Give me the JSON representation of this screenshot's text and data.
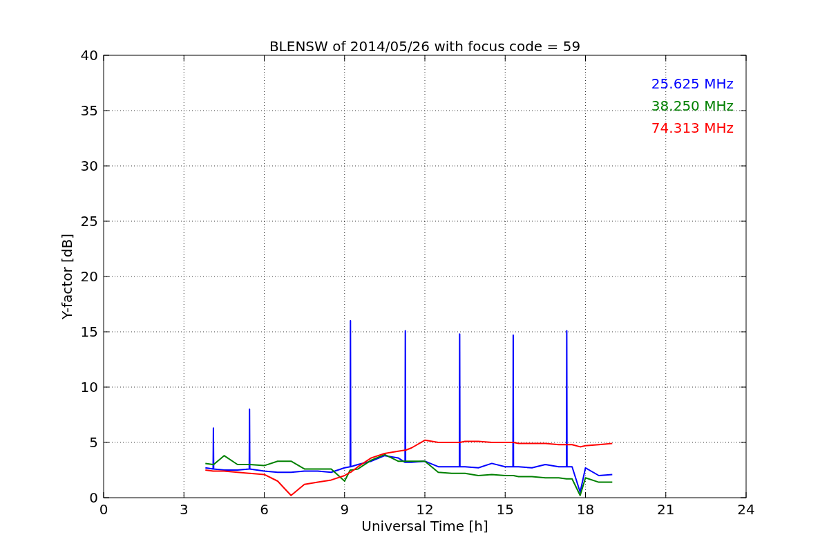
{
  "chart_data": {
    "type": "line",
    "title": "BLENSW of 2014/05/26 with focus code = 59",
    "xlabel": "Universal Time [h]",
    "ylabel": "Y-factor [dB]",
    "x": [
      3.8,
      4.09,
      4.1,
      4.11,
      4.5,
      5.0,
      5.44,
      5.45,
      5.46,
      6.0,
      6.5,
      7.0,
      7.5,
      8.0,
      8.5,
      9.0,
      9.21,
      9.22,
      9.23,
      9.5,
      10.0,
      10.5,
      11.0,
      11.26,
      11.27,
      11.28,
      11.5,
      12.0,
      12.5,
      13.0,
      13.29,
      13.3,
      13.31,
      13.5,
      14.0,
      14.5,
      15.0,
      15.29,
      15.3,
      15.31,
      15.5,
      16.0,
      16.5,
      17.0,
      17.29,
      17.3,
      17.31,
      17.5,
      17.8,
      18.0,
      18.5,
      19.0
    ],
    "series": [
      {
        "name": "25.625 MHz",
        "color": "#0000ff",
        "values": [
          2.7,
          2.6,
          6.3,
          2.6,
          2.5,
          2.5,
          2.6,
          8.0,
          2.6,
          2.4,
          2.3,
          2.3,
          2.4,
          2.4,
          2.3,
          2.7,
          2.8,
          16.0,
          2.8,
          3.0,
          3.3,
          3.8,
          3.6,
          3.2,
          15.1,
          3.2,
          3.2,
          3.3,
          2.8,
          2.8,
          2.8,
          14.8,
          2.8,
          2.8,
          2.7,
          3.1,
          2.8,
          2.8,
          14.7,
          2.8,
          2.8,
          2.7,
          3.0,
          2.8,
          2.8,
          15.1,
          2.8,
          2.8,
          0.5,
          2.7,
          2.0,
          2.1
        ]
      },
      {
        "name": "38.250 MHz",
        "color": "#008000",
        "values": [
          3.1,
          3.0,
          3.0,
          3.0,
          3.8,
          3.0,
          3.0,
          3.0,
          3.0,
          2.9,
          3.3,
          3.3,
          2.6,
          2.6,
          2.6,
          1.5,
          2.5,
          2.5,
          2.5,
          2.6,
          3.4,
          3.9,
          3.3,
          3.3,
          3.3,
          3.3,
          3.3,
          3.3,
          2.3,
          2.2,
          2.2,
          2.2,
          2.2,
          2.2,
          2.0,
          2.1,
          2.0,
          2.0,
          2.0,
          2.0,
          1.9,
          1.9,
          1.8,
          1.8,
          1.7,
          1.7,
          1.7,
          1.7,
          0.2,
          1.8,
          1.4,
          1.4
        ]
      },
      {
        "name": "74.313 MHz",
        "color": "#ff0000",
        "values": [
          2.5,
          2.4,
          2.4,
          2.4,
          2.4,
          2.3,
          2.2,
          2.2,
          2.2,
          2.1,
          1.5,
          0.2,
          1.2,
          1.4,
          1.6,
          2.0,
          2.3,
          2.3,
          2.3,
          2.8,
          3.6,
          4.0,
          4.2,
          4.3,
          4.3,
          4.3,
          4.5,
          5.2,
          5.0,
          5.0,
          5.0,
          5.0,
          5.0,
          5.1,
          5.1,
          5.0,
          5.0,
          5.0,
          5.0,
          5.0,
          4.9,
          4.9,
          4.9,
          4.8,
          4.8,
          4.8,
          4.8,
          4.8,
          4.6,
          4.7,
          4.8,
          4.9
        ]
      }
    ],
    "grid": true,
    "xlim": [
      0,
      24
    ],
    "ylim": [
      0,
      40
    ],
    "xticks": [
      0,
      3,
      6,
      9,
      12,
      15,
      18,
      21,
      24
    ],
    "yticks": [
      0,
      5,
      10,
      15,
      20,
      25,
      30,
      35,
      40
    ]
  }
}
